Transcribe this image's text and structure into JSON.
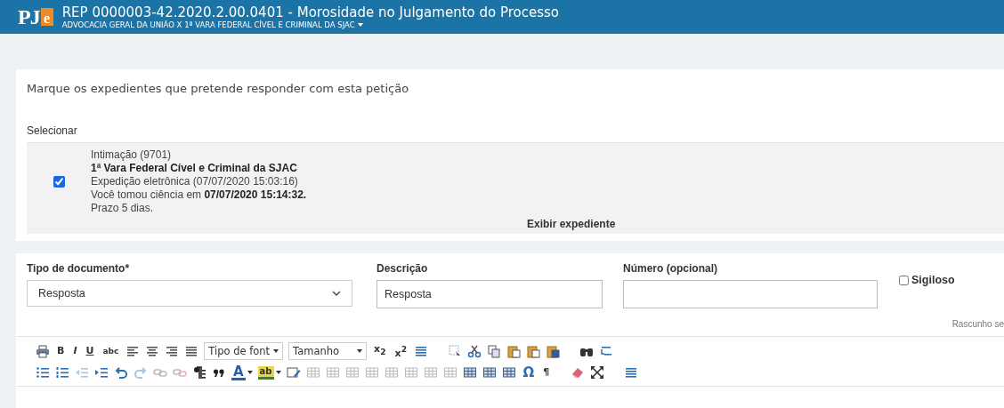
{
  "header": {
    "logo": {
      "text": "PJ",
      "accent": "e"
    },
    "title": "REP 0000003-42.2020.2.00.0401 - Morosidade no Julgamento do Processo",
    "subtitle": "ADVOCACIA GERAL DA UNIÃO X 1ª VARA FEDERAL CÍVEL E CRIMINAL DA SJAC"
  },
  "instruction": "Marque os expedientes que pretende responder com esta petição",
  "select_label": "Selecionar",
  "expedientes": [
    {
      "checked": true,
      "lines": [
        "Intimação (9701)",
        "**1ª Vara Federal Cível e Criminal da SJAC**",
        "Expedição eletrônica (07/07/2020 15:03:16)",
        "Você tomou ciência em **07/07/2020 15:14:32.**",
        "Prazo 5 dias."
      ],
      "link": "Exibir expediente"
    }
  ],
  "form": {
    "tipo": {
      "label": "Tipo de documento*",
      "value": "Resposta"
    },
    "descricao": {
      "label": "Descrição",
      "value": "Resposta"
    },
    "numero": {
      "label": "Número (opcional)"
    },
    "sigiloso": {
      "label": "Sigiloso",
      "checked": false
    },
    "status": "Rascunho se"
  },
  "toolbar": {
    "glyphs": [
      {
        "kind": "bold",
        "text": "B"
      },
      {
        "kind": "italic",
        "text": "I"
      },
      {
        "kind": "underline",
        "text": "U"
      },
      {
        "kind": "strike",
        "text": "abc"
      },
      {
        "kind": "plain",
        "text": "x$_{2}$"
      },
      {
        "kind": "plain",
        "text": "x$^{2}$"
      },
      {
        "kind": "textcolor",
        "text": "A"
      },
      {
        "kind": "highlight",
        "text": "ab"
      },
      {
        "kind": "symbol",
        "text": "Ω"
      },
      {
        "kind": "plain",
        "text": "¶"
      }
    ],
    "dropdowns": [
      "Tipo de font",
      "Tamanho"
    ]
  }
}
